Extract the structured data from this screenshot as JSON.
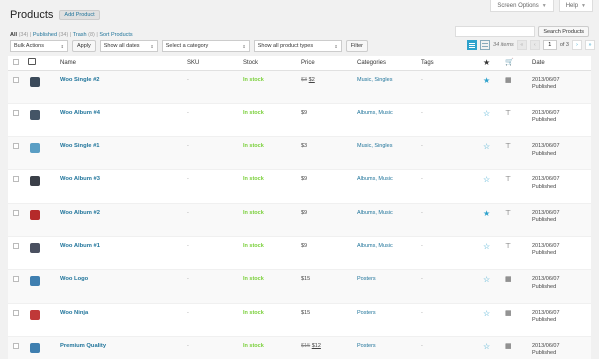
{
  "top": {
    "screen_options": "Screen Options",
    "help": "Help"
  },
  "header": {
    "title": "Products",
    "add_new": "Add Product"
  },
  "subsubsub": {
    "all": "All",
    "all_count": "(34)",
    "published": "Published",
    "published_count": "(34)",
    "trash": "Trash",
    "trash_count": "(8)",
    "sort": "Sort Products"
  },
  "search": {
    "button": "Search Products",
    "value": ""
  },
  "filters": {
    "bulk_actions": "Bulk Actions",
    "apply": "Apply",
    "dates": "Show all dates",
    "category": "Select a category",
    "product_types": "Show all product types",
    "filter": "Filter"
  },
  "pagination": {
    "items": "34 items",
    "first": "«",
    "prev": "‹",
    "current": "1",
    "of": "of 3",
    "next": "›",
    "last": "»"
  },
  "columns": {
    "name": "Name",
    "sku": "SKU",
    "stock": "Stock",
    "price": "Price",
    "categories": "Categories",
    "tags": "Tags",
    "date": "Date"
  },
  "rows": [
    {
      "name": "Woo Single #2",
      "sku": "-",
      "stock": "In stock",
      "price_old": "$3",
      "price": "$2",
      "categories": "Music, Singles",
      "tags": "-",
      "featured": true,
      "type": "grid",
      "date": "2013/06/07",
      "status": "Published",
      "thumb": "#3b4a5a"
    },
    {
      "name": "Woo Album #4",
      "sku": "-",
      "stock": "In stock",
      "price_old": "",
      "price": "$9",
      "categories": "Albums, Music",
      "tags": "-",
      "featured": false,
      "type": "download",
      "date": "2013/06/07",
      "status": "Published",
      "thumb": "#445566"
    },
    {
      "name": "Woo Single #1",
      "sku": "-",
      "stock": "In stock",
      "price_old": "",
      "price": "$3",
      "categories": "Music, Singles",
      "tags": "-",
      "featured": false,
      "type": "download",
      "date": "2013/06/07",
      "status": "Published",
      "thumb": "#5a9ec4"
    },
    {
      "name": "Woo Album #3",
      "sku": "-",
      "stock": "In stock",
      "price_old": "",
      "price": "$9",
      "categories": "Albums, Music",
      "tags": "-",
      "featured": false,
      "type": "download",
      "date": "2013/06/07",
      "status": "Published",
      "thumb": "#3a3f48"
    },
    {
      "name": "Woo Album #2",
      "sku": "-",
      "stock": "In stock",
      "price_old": "",
      "price": "$9",
      "categories": "Albums, Music",
      "tags": "-",
      "featured": true,
      "type": "download",
      "date": "2013/06/07",
      "status": "Published",
      "thumb": "#b52a2a"
    },
    {
      "name": "Woo Album #1",
      "sku": "-",
      "stock": "In stock",
      "price_old": "",
      "price": "$9",
      "categories": "Albums, Music",
      "tags": "-",
      "featured": false,
      "type": "download",
      "date": "2013/06/07",
      "status": "Published",
      "thumb": "#4a5060"
    },
    {
      "name": "Woo Logo",
      "sku": "-",
      "stock": "In stock",
      "price_old": "",
      "price": "$15",
      "categories": "Posters",
      "tags": "-",
      "featured": false,
      "type": "grid",
      "date": "2013/06/07",
      "status": "Published",
      "thumb": "#3f7fb0"
    },
    {
      "name": "Woo Ninja",
      "sku": "-",
      "stock": "In stock",
      "price_old": "",
      "price": "$15",
      "categories": "Posters",
      "tags": "-",
      "featured": false,
      "type": "grid",
      "date": "2013/06/07",
      "status": "Published",
      "thumb": "#c03838"
    },
    {
      "name": "Premium Quality",
      "sku": "-",
      "stock": "In stock",
      "price_old": "$15",
      "price": "$12",
      "categories": "Posters",
      "tags": "-",
      "featured": false,
      "type": "grid",
      "date": "2013/06/07",
      "status": "Published",
      "thumb": "#3f7fb0"
    }
  ]
}
